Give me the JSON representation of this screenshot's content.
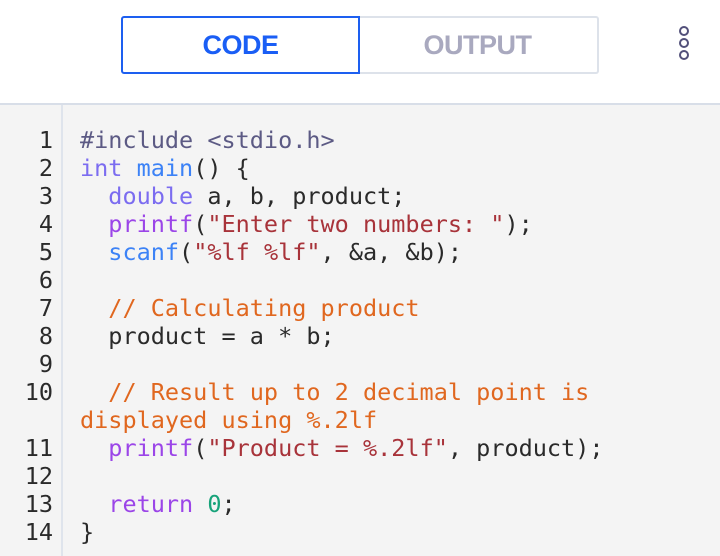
{
  "tabs": {
    "code": "CODE",
    "output": "OUTPUT",
    "active": "code"
  },
  "menu_icon": "more-vertical-icon",
  "colors": {
    "accent": "#1a5ef5",
    "inactive_tab": "#a9a9bf",
    "editor_bg": "#f4f4f4"
  },
  "code_lines": [
    {
      "n": "1",
      "tokens": [
        {
          "t": "#include <stdio.h>",
          "c": "pre"
        }
      ]
    },
    {
      "n": "2",
      "tokens": [
        {
          "t": "int",
          "c": "type"
        },
        {
          "t": " ",
          "c": "plain"
        },
        {
          "t": "main",
          "c": "fn"
        },
        {
          "t": "() {",
          "c": "plain"
        }
      ]
    },
    {
      "n": "3",
      "tokens": [
        {
          "t": "  ",
          "c": "plain"
        },
        {
          "t": "double",
          "c": "type"
        },
        {
          "t": " a, b, product;",
          "c": "plain"
        }
      ]
    },
    {
      "n": "4",
      "tokens": [
        {
          "t": "  ",
          "c": "plain"
        },
        {
          "t": "printf",
          "c": "call"
        },
        {
          "t": "(",
          "c": "plain"
        },
        {
          "t": "\"Enter two numbers: \"",
          "c": "str"
        },
        {
          "t": ");",
          "c": "plain"
        }
      ]
    },
    {
      "n": "5",
      "tokens": [
        {
          "t": "  ",
          "c": "plain"
        },
        {
          "t": "scanf",
          "c": "fn"
        },
        {
          "t": "(",
          "c": "plain"
        },
        {
          "t": "\"%lf %lf\"",
          "c": "str"
        },
        {
          "t": ", &a, &b);",
          "c": "plain"
        }
      ]
    },
    {
      "n": "6",
      "tokens": []
    },
    {
      "n": "7",
      "tokens": [
        {
          "t": "  ",
          "c": "plain"
        },
        {
          "t": "// Calculating product",
          "c": "com"
        }
      ]
    },
    {
      "n": "8",
      "tokens": [
        {
          "t": "  product = a * b;",
          "c": "plain"
        }
      ]
    },
    {
      "n": "9",
      "tokens": []
    },
    {
      "n": "10",
      "tokens": [
        {
          "t": "  ",
          "c": "plain"
        },
        {
          "t": "// Result up to 2 decimal point is displayed using %.2lf",
          "c": "com"
        }
      ]
    },
    {
      "n": "11",
      "tokens": [
        {
          "t": "  ",
          "c": "plain"
        },
        {
          "t": "printf",
          "c": "call"
        },
        {
          "t": "(",
          "c": "plain"
        },
        {
          "t": "\"Product = %.2lf\"",
          "c": "str"
        },
        {
          "t": ", product);",
          "c": "plain"
        }
      ]
    },
    {
      "n": "12",
      "tokens": []
    },
    {
      "n": "13",
      "tokens": [
        {
          "t": "  ",
          "c": "plain"
        },
        {
          "t": "return",
          "c": "kw"
        },
        {
          "t": " ",
          "c": "plain"
        },
        {
          "t": "0",
          "c": "num"
        },
        {
          "t": ";",
          "c": "plain"
        }
      ]
    },
    {
      "n": "14",
      "tokens": [
        {
          "t": "}",
          "c": "plain"
        }
      ]
    }
  ]
}
